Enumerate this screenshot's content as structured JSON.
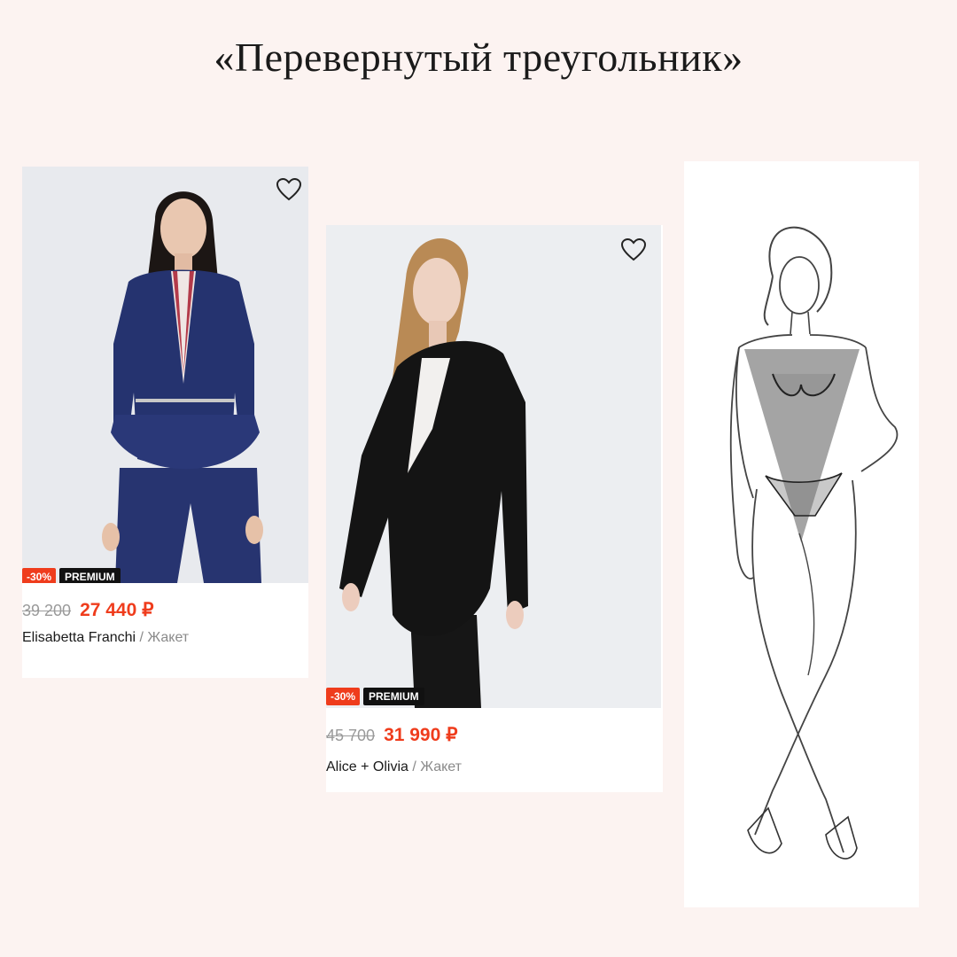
{
  "title": "«Перевернутый треугольник»",
  "products": [
    {
      "old_price": "39 200",
      "new_price": "27 440 ₽",
      "discount": "-30%",
      "badge": "PREMIUM",
      "brand": "Elisabetta Franchi",
      "separator": " / ",
      "category": "Жакет"
    },
    {
      "old_price": "45 700",
      "new_price": "31 990 ₽",
      "discount": "-30%",
      "badge": "PREMIUM",
      "brand": "Alice + Olivia",
      "separator": " / ",
      "category": "Жакет"
    }
  ],
  "icons": [
    "heart-icon"
  ],
  "colors": {
    "background": "#fcf3f1",
    "discount": "#ef3c1c",
    "premium": "#111111",
    "jacket_1": "#25336f",
    "jacket_2": "#141414"
  }
}
